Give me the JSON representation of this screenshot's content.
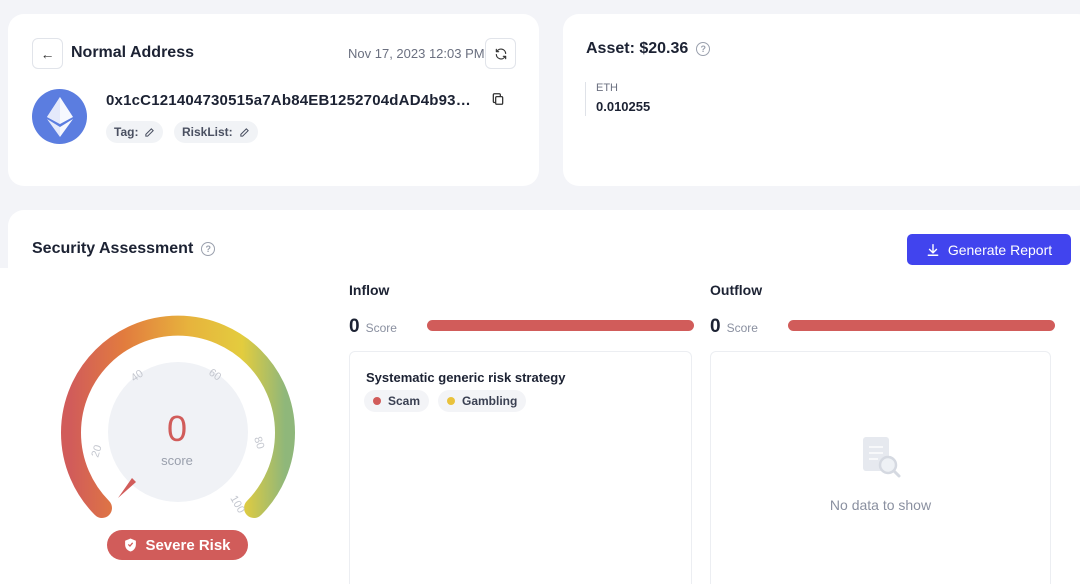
{
  "address_card": {
    "title": "Normal Address",
    "datetime": "Nov 17, 2023 12:03 PM",
    "address": "0x1cC121404730515a7Ab84EB1252704dAD4b93…",
    "tag_label": "Tag:",
    "risklist_label": "RiskList:"
  },
  "asset_card": {
    "title": "Asset: $20.36",
    "items": [
      {
        "symbol": "ETH",
        "amount": "0.010255"
      }
    ]
  },
  "security": {
    "title": "Security Assessment",
    "generate_button": "Generate Report",
    "score": "0",
    "score_label": "score",
    "risk_level": "Severe Risk",
    "gauge_ticks": [
      "20",
      "40",
      "60",
      "80",
      "100"
    ],
    "inflow": {
      "label": "Inflow",
      "score": "0",
      "score_label": "Score",
      "strategy_title": "Systematic generic risk strategy",
      "tags": [
        {
          "label": "Scam",
          "color": "#d15c5a"
        },
        {
          "label": "Gambling",
          "color": "#e9c23c"
        }
      ]
    },
    "outflow": {
      "label": "Outflow",
      "score": "0",
      "score_label": "Score",
      "empty_text": "No data to show"
    }
  },
  "colors": {
    "accent": "#4144ee",
    "risk": "#d15c5a",
    "eth": "#5b7de0"
  }
}
